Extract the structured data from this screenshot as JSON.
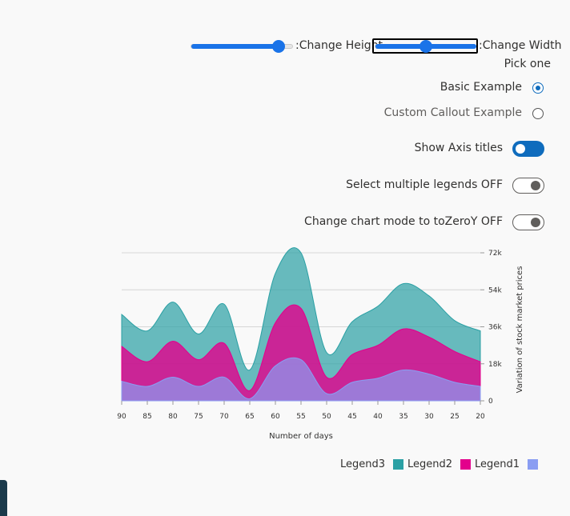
{
  "controls": {
    "height_slider_label": ":Change Height",
    "height_value": 0.85,
    "width_slider_label": ":Change Width",
    "width_value": 0.5,
    "radio_group_label": "Pick one",
    "radio_basic": "Basic Example",
    "radio_custom": "Custom Callout Example",
    "toggle_axis_titles": "Show Axis titles",
    "toggle_multi_legends": "Select multiple legends OFF",
    "toggle_chart_mode": "Change chart mode to toZeroY OFF"
  },
  "colors": {
    "accent": "#0f6cbd",
    "legend1": "#8a9df2",
    "legend2": "#e3008c",
    "legend3": "#2aa0a4"
  },
  "chart_data": {
    "type": "area",
    "stacked": true,
    "xlabel": "Number of days",
    "ylabel": "Variation of stock market prices",
    "x_ticks": [
      "90",
      "85",
      "80",
      "75",
      "70",
      "65",
      "60",
      "55",
      "50",
      "45",
      "40",
      "35",
      "30",
      "25",
      "20"
    ],
    "y_ticks": [
      "0",
      "18k",
      "36k",
      "54k",
      "72k"
    ],
    "xlim": [
      90,
      20
    ],
    "ylim": [
      0,
      72000
    ],
    "x": [
      90,
      85,
      80,
      75,
      70,
      65,
      60,
      55,
      50,
      45,
      40,
      35,
      30,
      25,
      20
    ],
    "series": [
      {
        "name": "Legend1",
        "values": [
          9500,
          7000,
          11500,
          7000,
          11500,
          1000,
          17000,
          20000,
          3500,
          9000,
          11000,
          15000,
          13000,
          9000,
          7000
        ]
      },
      {
        "name": "Legend2",
        "values": [
          17000,
          12000,
          17500,
          13000,
          16500,
          4000,
          21000,
          25000,
          8000,
          13500,
          16000,
          20000,
          18000,
          15000,
          12000
        ]
      },
      {
        "name": "Legend3",
        "values": [
          15500,
          15000,
          19000,
          12500,
          19000,
          10000,
          24000,
          27000,
          12000,
          16000,
          19000,
          22000,
          20000,
          15000,
          15000
        ]
      }
    ],
    "grid": true,
    "legend_position": "bottom-right"
  }
}
